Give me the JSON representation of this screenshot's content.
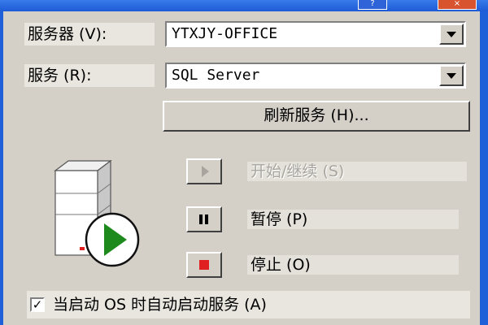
{
  "labels": {
    "server": "服务器 (V):",
    "service": "服务 (R):"
  },
  "server_combo": {
    "value": "YTXJY-OFFICE"
  },
  "service_combo": {
    "value": "SQL Server"
  },
  "refresh_button": {
    "label": "刷新服务 (H)..."
  },
  "controls": {
    "start": {
      "label": "开始/继续 (S)",
      "enabled": false
    },
    "pause": {
      "label": "暂停 (P)",
      "enabled": true
    },
    "stop": {
      "label": "停止 (O)",
      "enabled": true
    }
  },
  "autostart": {
    "label": "当启动 OS 时自动启动服务 (A)",
    "checked": true,
    "mark": "✓"
  },
  "window_buttons": {
    "help": "?",
    "close": "×"
  },
  "colors": {
    "stop_red": "#e02020",
    "play_green": "#1e8a1e",
    "face": "#d4d0c8"
  },
  "icons": {
    "server": "server-tower-icon",
    "status": "running-play-icon"
  }
}
